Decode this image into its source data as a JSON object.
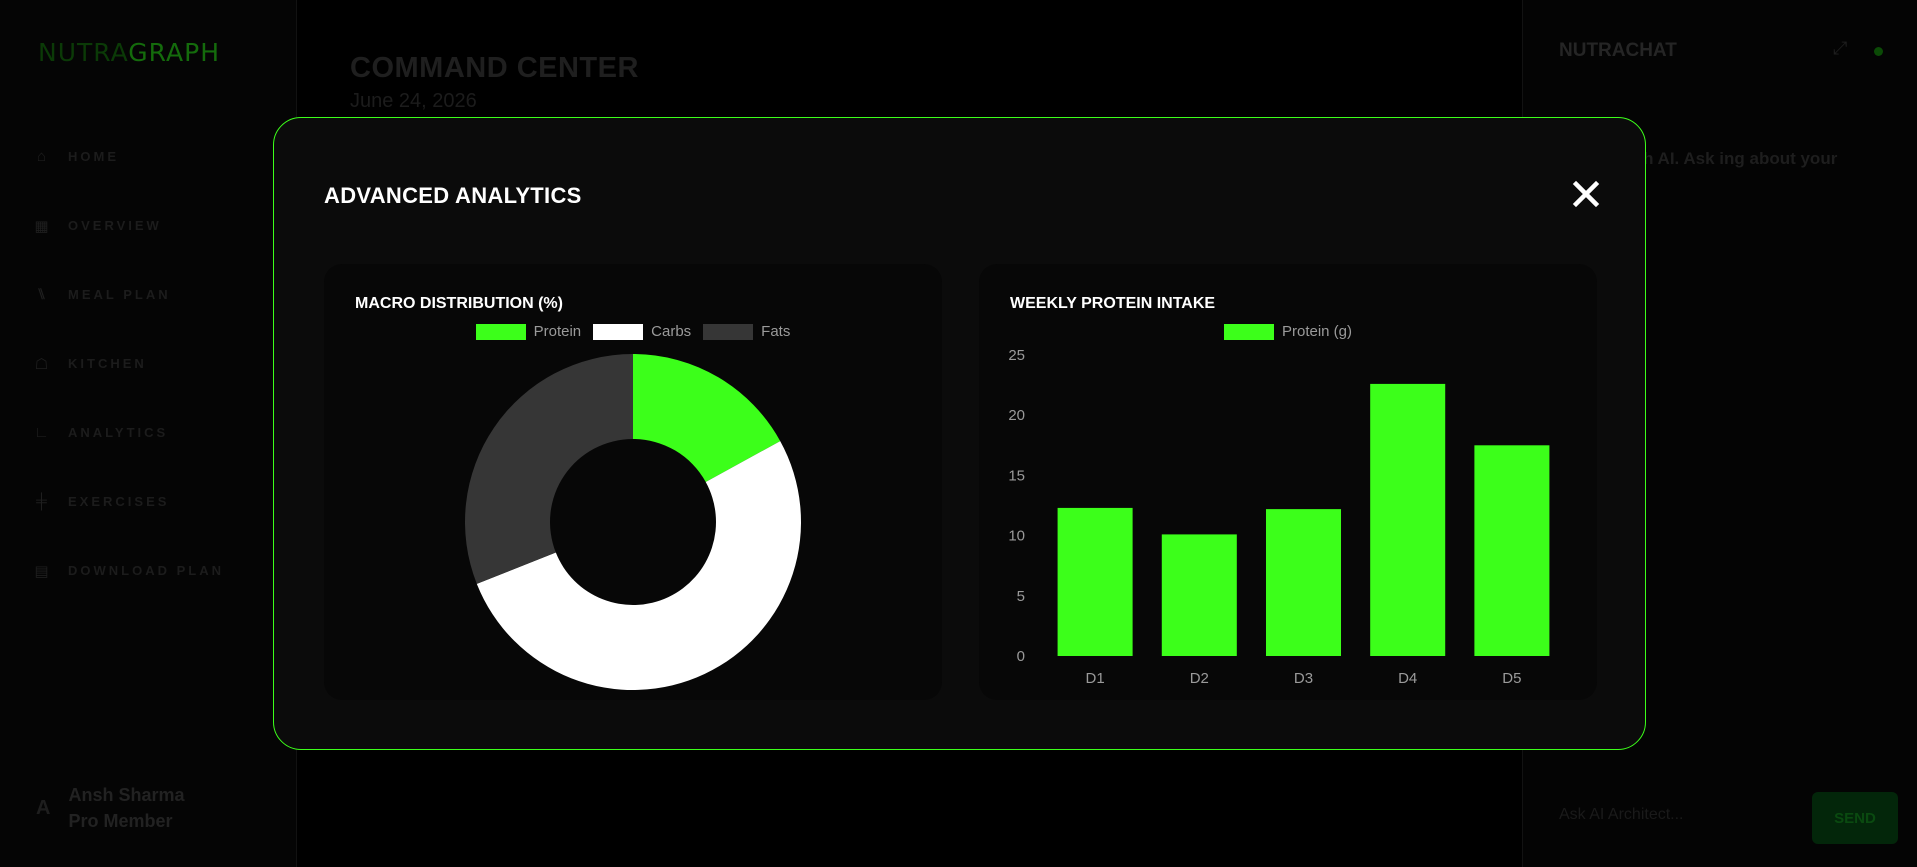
{
  "app": {
    "logo_a": "NUTRA",
    "logo_b": "GRAPH"
  },
  "sidebar": {
    "items": [
      {
        "label": "HOME",
        "icon": "home-icon"
      },
      {
        "label": "OVERVIEW",
        "icon": "grid-icon"
      },
      {
        "label": "MEAL PLAN",
        "icon": "utensils-icon"
      },
      {
        "label": "KITCHEN",
        "icon": "chef-hat-icon"
      },
      {
        "label": "ANALYTICS",
        "icon": "chart-icon"
      },
      {
        "label": "EXERCISES",
        "icon": "dumbbell-icon"
      },
      {
        "label": "DOWNLOAD PLAN",
        "icon": "file-icon"
      }
    ],
    "user": {
      "initial": "A",
      "name": "Ansh Sharma",
      "tier": "Pro Member"
    }
  },
  "main": {
    "title": "COMMAND CENTER",
    "date": "June 24, 2026"
  },
  "chat": {
    "title": "NUTRACHAT",
    "message": "NutraGraph AI. Ask ing about your diet.",
    "input_placeholder": "Ask AI Architect...",
    "send_label": "SEND"
  },
  "modal": {
    "title": "ADVANCED ANALYTICS",
    "close_glyph": "✕"
  },
  "colors": {
    "accent": "#3cff1a",
    "carbs": "#ffffff",
    "fats": "#363636"
  },
  "chart_data": [
    {
      "type": "pie",
      "variant": "doughnut",
      "title": "MACRO DISTRIBUTION (%)",
      "labels": [
        "Protein",
        "Carbs",
        "Fats"
      ],
      "values": [
        17,
        52,
        31
      ],
      "colors": [
        "#3cff1a",
        "#ffffff",
        "#363636"
      ],
      "legend": "top"
    },
    {
      "type": "bar",
      "title": "WEEKLY PROTEIN INTAKE",
      "categories": [
        "D1",
        "D2",
        "D3",
        "D4",
        "D5"
      ],
      "series": [
        {
          "name": "Protein (g)",
          "values": [
            12.3,
            10.1,
            12.2,
            22.6,
            17.5
          ],
          "color": "#3cff1a"
        }
      ],
      "ylim": [
        0,
        25
      ],
      "yticks": [
        0,
        5,
        10,
        15,
        20,
        25
      ],
      "legend": "top",
      "grid": false
    }
  ]
}
